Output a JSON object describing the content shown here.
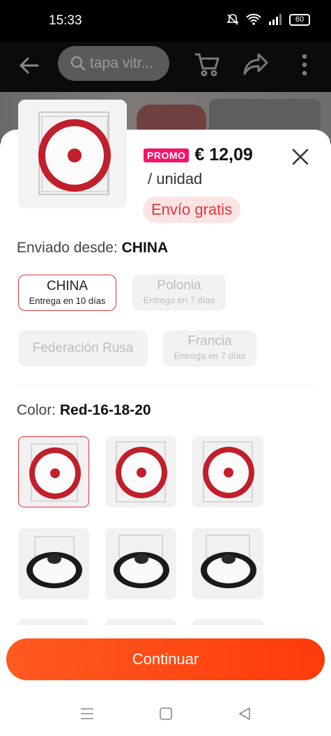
{
  "status_bar": {
    "time": "15:33",
    "battery": "60"
  },
  "app_bar": {
    "search_placeholder": "tapa vitr..."
  },
  "product": {
    "promo_badge": "PROMO",
    "price": "€ 12,09",
    "unit": "/ unidad",
    "shipping": "Envío gratis"
  },
  "ship_from": {
    "label": "Enviado desde: ",
    "value": "CHINA",
    "options": [
      {
        "name": "CHINA",
        "delivery": "Entrega en 10 días"
      },
      {
        "name": "Polonia",
        "delivery": "Entrega en 7 días"
      },
      {
        "name": "Federación Rusa",
        "delivery": ""
      },
      {
        "name": "Francia",
        "delivery": "Entrega en 7 días"
      }
    ]
  },
  "color": {
    "label": "Color: ",
    "value": "Red-16-18-20",
    "swatches": [
      "red-ring-lid",
      "red-ring-lid",
      "red-ring-lid",
      "black-ring-lid",
      "black-ring-lid",
      "black-ring-lid"
    ]
  },
  "cta": {
    "label": "Continuar"
  },
  "colors": {
    "accent": "#e8333a",
    "promo": "#f5136a",
    "cta": "#ff4a14"
  }
}
